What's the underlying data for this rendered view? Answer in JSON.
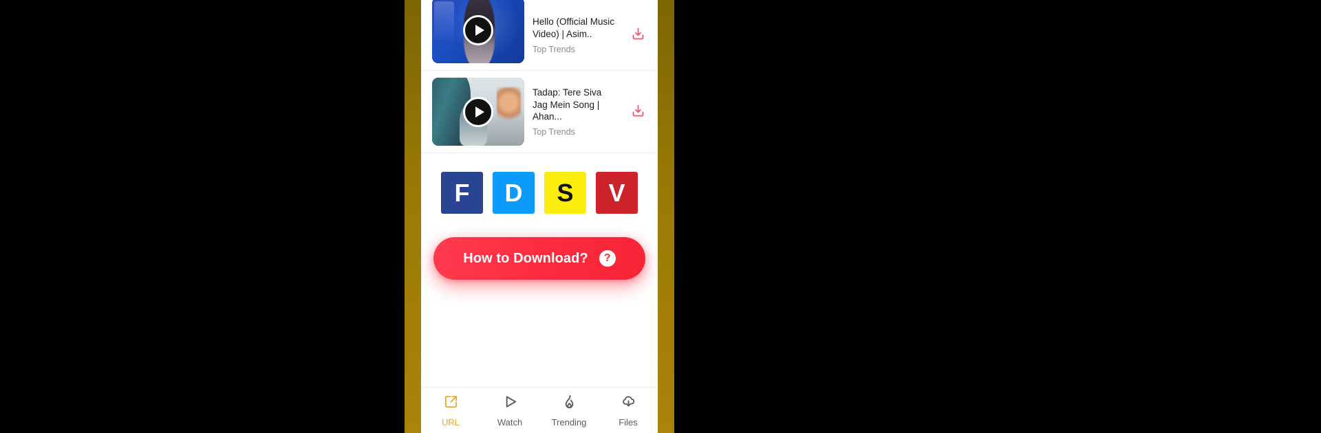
{
  "frame": {
    "band_color": "#9a7a06",
    "backdrop_color": "#000000"
  },
  "theme": {
    "accent_red": "#fb2d40",
    "active_tab_color": "#e8a838",
    "download_icon_color": "#e8556a",
    "divider_color": "#ececec",
    "title_color": "#1b1b1b",
    "subtitle_color": "#8c8c8c"
  },
  "video_list": [
    {
      "title": "Hello (Official Music Video) | Asim..",
      "subtitle": "Top Trends",
      "thumbnail": "woman-with-headphones-blue-wall",
      "play_icon": "play-icon",
      "download_icon": "download-icon"
    },
    {
      "title": "Tadap: Tere Siva Jag Mein Song | Ahan...",
      "subtitle": "Top Trends",
      "thumbnail": "person-leaning-out-car-window",
      "play_icon": "play-icon",
      "download_icon": "download-icon"
    }
  ],
  "social_tiles": [
    {
      "letter": "F",
      "name": "facebook-tile",
      "bg": "#2a4494",
      "fg": "#ffffff"
    },
    {
      "letter": "D",
      "name": "dailymotion-tile",
      "bg": "#0d9bfb",
      "fg": "#ffffff"
    },
    {
      "letter": "S",
      "name": "snapchat-tile",
      "bg": "#fbed0d",
      "fg": "#111111"
    },
    {
      "letter": "V",
      "name": "vimeo-tile",
      "bg": "#cc2229",
      "fg": "#ffffff"
    }
  ],
  "howto": {
    "label": "How to Download?",
    "help_icon": "question-mark-icon",
    "help_glyph": "?"
  },
  "bottom_nav": {
    "items": [
      {
        "label": "URL",
        "icon": "external-link-icon",
        "active": true
      },
      {
        "label": "Watch",
        "icon": "play-outline-icon",
        "active": false
      },
      {
        "label": "Trending",
        "icon": "flame-icon",
        "active": false
      },
      {
        "label": "Files",
        "icon": "cloud-download-icon",
        "active": false
      }
    ]
  }
}
